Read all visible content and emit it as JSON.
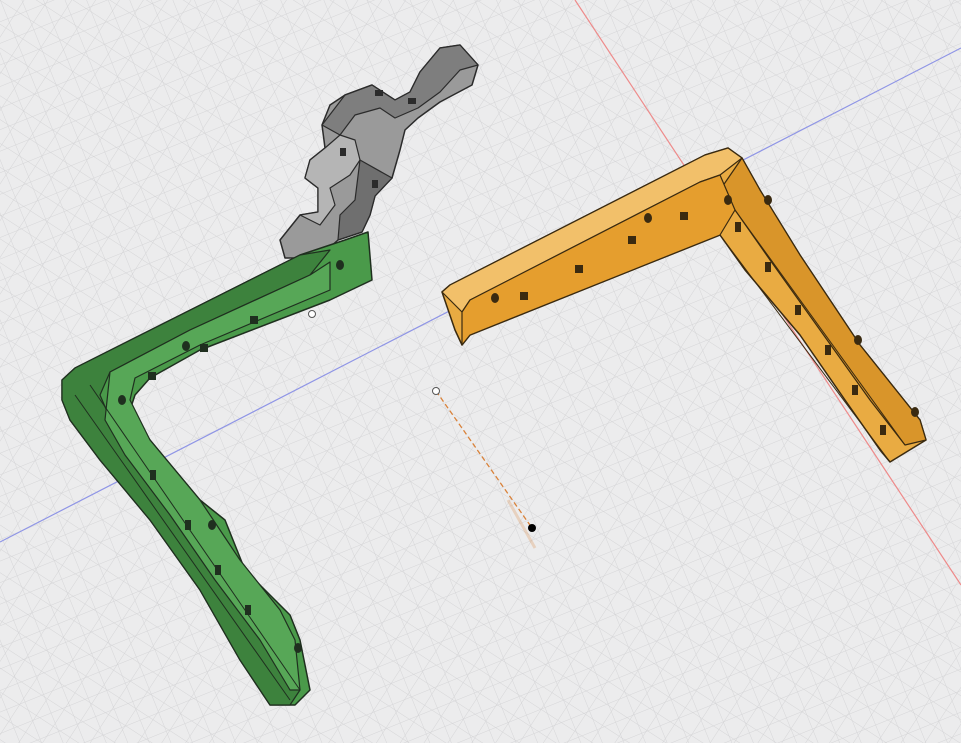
{
  "app": {
    "view": "3d-design-canvas"
  },
  "scene": {
    "grid": true,
    "axes": {
      "x_color": "#ee8a8a",
      "y_color": "#8f95e6"
    },
    "parts": [
      {
        "name": "gray-zigzag-bracket",
        "color": "#8b8b8b"
      },
      {
        "name": "green-l-bracket",
        "color": "#3f8a3f"
      },
      {
        "name": "orange-l-bracket",
        "color": "#e8a83d"
      }
    ],
    "measure": {
      "color": "#d9823a"
    }
  }
}
